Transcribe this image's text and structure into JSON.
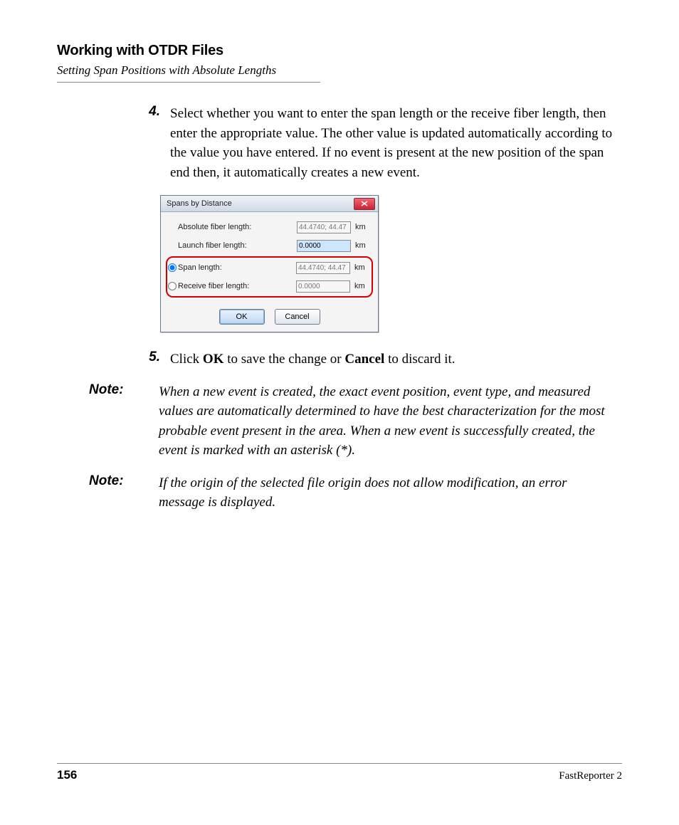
{
  "header": {
    "title": "Working with OTDR Files",
    "subtitle": "Setting Span Positions with Absolute Lengths"
  },
  "steps": {
    "s4": {
      "num": "4.",
      "text": "Select whether you want to enter the span length or the receive fiber length, then enter the appropriate value. The other value is updated automatically according to the value you have entered. If no event is present at the new position of the span end then, it automatically creates a new event."
    },
    "s5": {
      "num": "5.",
      "pre": "Click ",
      "ok": "OK",
      "mid": " to save the change or ",
      "cancel": "Cancel",
      "post": " to discard it."
    }
  },
  "notes": {
    "label": "Note:",
    "n1": "When a new event is created, the exact event position, event type, and measured values are automatically determined to have the best characterization for the most probable event present in the area. When a new event is successfully created, the event is marked with an asterisk (*).",
    "n2": "If the origin of the selected file origin does not allow modification, an error message is displayed."
  },
  "dialog": {
    "title": "Spans by Distance",
    "unit": "km",
    "rows": {
      "abs": {
        "label": "Absolute fiber length:",
        "value": "44.4740; 44.47"
      },
      "launch": {
        "label": "Launch fiber length:",
        "value": "0.0000"
      },
      "span": {
        "label": "Span length:",
        "value": "44.4740; 44.47"
      },
      "recv": {
        "label": "Receive fiber length:",
        "value": "0.0000"
      }
    },
    "buttons": {
      "ok": "OK",
      "cancel": "Cancel"
    }
  },
  "footer": {
    "page": "156",
    "product": "FastReporter 2"
  }
}
